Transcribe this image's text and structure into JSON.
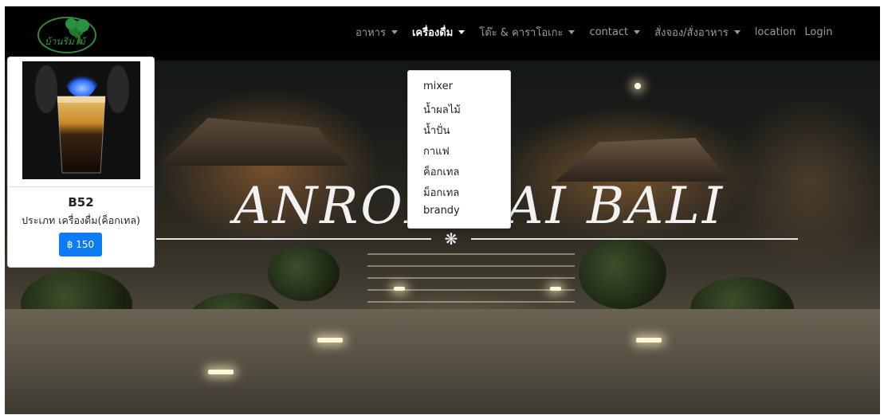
{
  "navbar": {
    "logo_text": "บ้านริมไม้",
    "items": [
      {
        "label": "อาหาร",
        "has_dropdown": true,
        "active": false
      },
      {
        "label": "เครื่องดื่ม",
        "has_dropdown": true,
        "active": true
      },
      {
        "label": "โต๊ะ & คาราโอเกะ",
        "has_dropdown": true,
        "active": false
      },
      {
        "label": "contact",
        "has_dropdown": true,
        "active": false
      },
      {
        "label": "สั่งจอง/สั่งอาหาร",
        "has_dropdown": true,
        "active": false
      },
      {
        "label": "location",
        "has_dropdown": false,
        "active": false
      },
      {
        "label": "Login",
        "has_dropdown": false,
        "active": false
      }
    ]
  },
  "dropdown": {
    "items": [
      "mixer",
      "น้ำผลไม้",
      "น้ำปั่น",
      "กาแฟ",
      "ค็อกเทล",
      "ม็อกเทล",
      "brandy"
    ]
  },
  "hero": {
    "title": "ANRONMAI BALI",
    "ornament": "❋"
  },
  "product_card": {
    "name": "B52",
    "type": "ประเภท เครื่องดื่ม(ค็อกเทล)",
    "price_label": "฿ 150"
  },
  "colors": {
    "accent": "#0d7cf2",
    "navbar": "#000000"
  }
}
